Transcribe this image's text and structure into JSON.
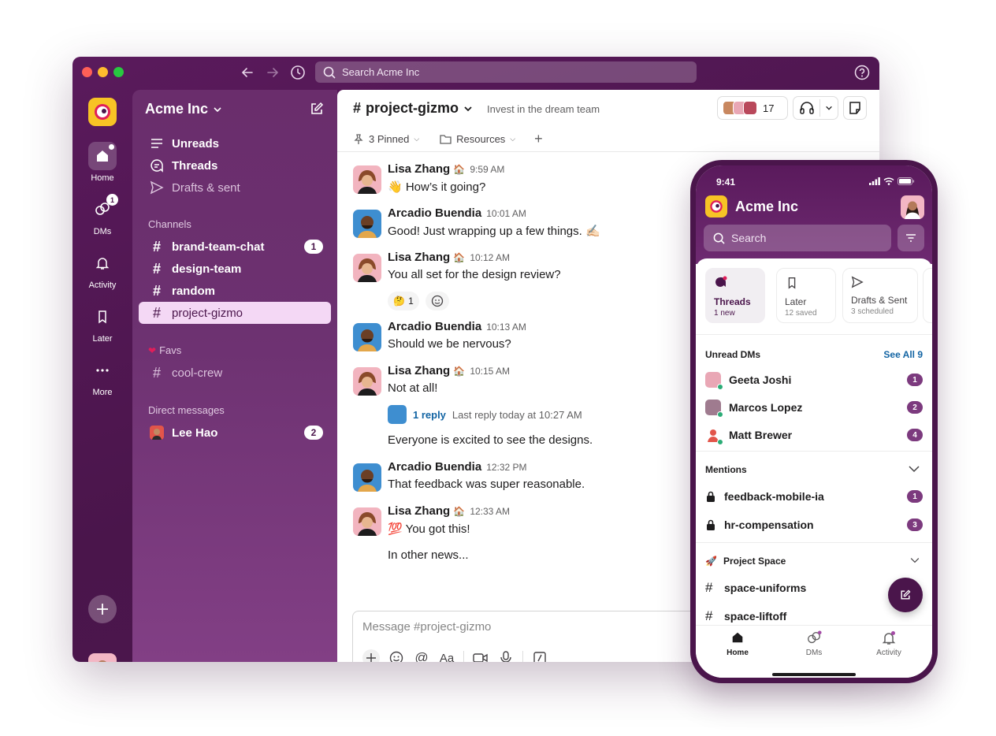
{
  "desktop": {
    "search_placeholder": "Search Acme Inc",
    "rail": {
      "home": "Home",
      "dms": "DMs",
      "dms_badge": "1",
      "activity": "Activity",
      "later": "Later",
      "more": "More"
    },
    "sidebar": {
      "workspace": "Acme Inc",
      "nav": [
        "Unreads",
        "Threads",
        "Drafts & sent"
      ],
      "channels_header": "Channels",
      "channels": [
        {
          "name": "brand-team-chat",
          "badge": "1"
        },
        {
          "name": "design-team"
        },
        {
          "name": "random"
        },
        {
          "name": "project-gizmo"
        }
      ],
      "favs_header": "Favs",
      "favs": [
        {
          "name": "cool-crew"
        }
      ],
      "dm_header": "Direct messages",
      "dms": [
        {
          "name": "Lee Hao",
          "badge": "2"
        }
      ]
    },
    "channel": {
      "name": "project-gizmo",
      "topic": "Invest in the dream team",
      "member_count": "17",
      "pinned": "3 Pinned",
      "resources": "Resources"
    },
    "messages": [
      {
        "author": "Lisa Zhang",
        "time": "9:59 AM",
        "text": "👋 How’s it going?"
      },
      {
        "author": "Arcadio Buendia",
        "time": "10:01 AM",
        "text": "Good! Just wrapping up a few things. ✍🏻"
      },
      {
        "author": "Lisa Zhang",
        "time": "10:12 AM",
        "text": "You all set for the design review?",
        "reaction_emoji": "🤔",
        "reaction_count": "1"
      },
      {
        "author": "Arcadio Buendia",
        "time": "10:13 AM",
        "text": "Should we be nervous?"
      },
      {
        "author": "Lisa Zhang",
        "time": "10:15 AM",
        "text": "Not at all!",
        "reply_count": "1 reply",
        "reply_meta": "Last reply today at 10:27 AM",
        "followup": "Everyone is excited to see the designs."
      },
      {
        "author": "Arcadio Buendia",
        "time": "12:32 PM",
        "text": "That feedback was super reasonable."
      },
      {
        "author": "Lisa Zhang",
        "time": "12:33 AM",
        "text": "💯 You got this!",
        "followup": "In other news..."
      }
    ],
    "composer_placeholder": "Message #project-gizmo"
  },
  "phone": {
    "time": "9:41",
    "workspace": "Acme Inc",
    "search_placeholder": "Search",
    "cards": [
      {
        "title": "Threads",
        "sub": "1 new"
      },
      {
        "title": "Later",
        "sub": "12 saved"
      },
      {
        "title": "Drafts & Sent",
        "sub": "3 scheduled"
      }
    ],
    "unread_dms_header": "Unread DMs",
    "see_all": "See All 9",
    "unread_dms": [
      {
        "name": "Geeta Joshi",
        "badge": "1"
      },
      {
        "name": "Marcos Lopez",
        "badge": "2"
      },
      {
        "name": "Matt Brewer",
        "badge": "4"
      }
    ],
    "mentions_header": "Mentions",
    "mentions": [
      {
        "name": "feedback-mobile-ia",
        "badge": "1"
      },
      {
        "name": "hr-compensation",
        "badge": "3"
      }
    ],
    "project_header": "Project Space",
    "project_channels": [
      {
        "name": "space-uniforms"
      },
      {
        "name": "space-liftoff"
      }
    ],
    "tabs": [
      "Home",
      "DMs",
      "Activity"
    ]
  },
  "colors": {
    "aubergine": "#4a154b",
    "accent_yellow": "#f7c325",
    "online": "#2bac76",
    "link": "#1264a3"
  }
}
